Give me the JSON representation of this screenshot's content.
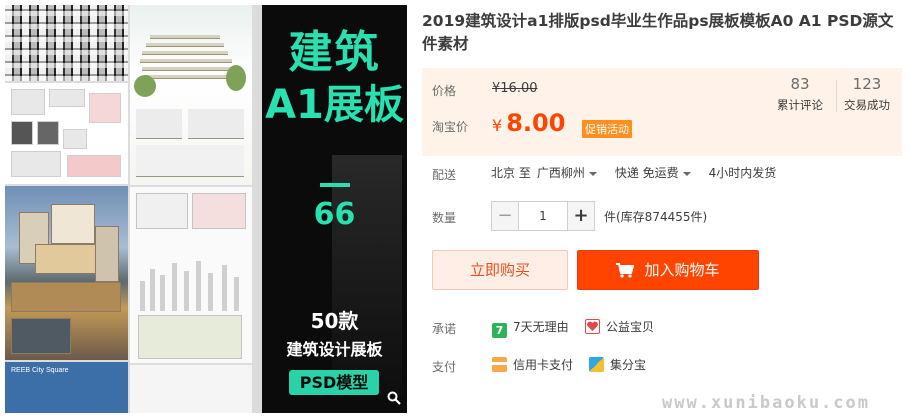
{
  "product": {
    "title": "2019建筑设计a1排版psd毕业生作品ps展板模板A0 A1 PSD源文件素材",
    "poster": {
      "line1": "建筑",
      "line2": "A1展板",
      "number": "66",
      "count": "50款",
      "subtitle": "建筑设计展板",
      "badge": "PSD模型",
      "thumb_caption": "REEB City Square"
    }
  },
  "price": {
    "price_label": "价格",
    "original": "¥16.00",
    "taobao_label": "淘宝价",
    "currency": "¥",
    "current": "8.00",
    "promo_tag": "促销活动",
    "reviews_count": "83",
    "reviews_label": "累计评论",
    "trades_count": "123",
    "trades_label": "交易成功"
  },
  "shipping": {
    "label": "配送",
    "from": "北京 至",
    "to": "广西柳州",
    "method": "快递 免运费",
    "dispatch": "4小时内发货"
  },
  "quantity": {
    "label": "数量",
    "minus": "−",
    "value": "1",
    "plus": "+",
    "stock": "件(库存874455件)"
  },
  "actions": {
    "buy_now": "立即购买",
    "add_to_cart": "加入购物车"
  },
  "service": {
    "promise_label": "承诺",
    "return_policy": "7天无理由",
    "charity": "公益宝贝",
    "payment_label": "支付",
    "credit_card": "信用卡支付",
    "jifenbao": "集分宝",
    "return_icon_glyph": "7"
  },
  "watermark": "www.xunibaoku.com",
  "colors": {
    "accent": "#ff4400",
    "price_bg": "#fff2e8",
    "poster_green": "#29e0b0",
    "promo_orange": "#ff8f1f"
  }
}
